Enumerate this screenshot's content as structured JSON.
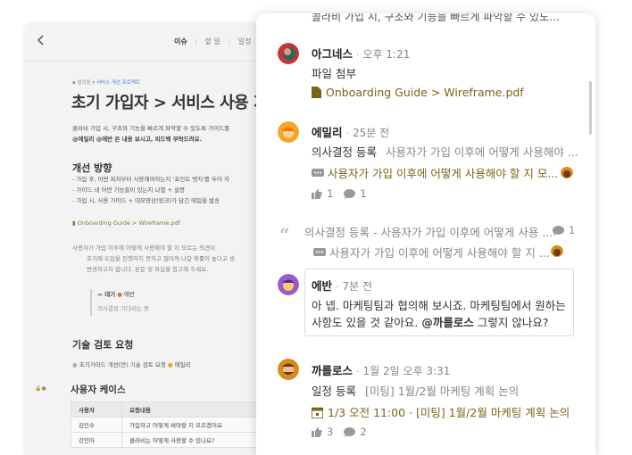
{
  "doc": {
    "tabs": [
      "이슈",
      "할 일",
      "일정"
    ],
    "breadcrumb": {
      "parent": "발의팀",
      "project": "서비스 개선 프로젝트"
    },
    "title": "초기 가입자 > 서비스 사용 가이드",
    "intro_line1": "콜라비 가입 시, 구조와 기능을 빠르게 파악할 수 있도록 가이드를",
    "intro_line2": "@에밀리 @에반 은 내용 보시고, 피드백 부탁드려요.",
    "section1_title": "개선 방향",
    "bullets": [
      "- 가입 후, 어떤 피처부터 사용해야하는지 '포인트 뱃지'를 두어 자",
      "- 가이드 내 어떤 기능들이 있는지 나열 + 설명",
      "- 가입 시, 사용 가이드 + 데모영상(링크)가 담긴 메일을 발송"
    ],
    "file_name": "Onboarding Guide > Wireframe.pdf",
    "note_lines": [
      "사용자가 가입 이후에 어떻게 사용해야 할 지 모르는 의견이",
      "초기에 도입을 진행하지 못하고 떨어져 나갈 확률이 높다고 생",
      "변경하고자 합니다. 본문 및 파일을 참고해 주세요."
    ],
    "quote_status": "대기",
    "quote_user": "에반",
    "quote_text": "의사결정 기다리는 중",
    "section2_title": "기술 검토 요청",
    "tech_item": "초기가이드 개선(안) 기술 검토 요청",
    "tech_user": "에밀리",
    "section3_title": "사용자 케이스",
    "table": {
      "headers": [
        "사용자",
        "요청내용"
      ],
      "rows": [
        [
          "김민수",
          "가입하고 어떻게 써야할 지 모르겠어요"
        ],
        [
          "강민아",
          "콜라비는 어떻게 사용할 수 있나요?"
        ]
      ]
    }
  },
  "panel": {
    "cut_line": "콜라비 가입 시, 구조와 기능을 빠르게 파악할 수 있도…",
    "comments": [
      {
        "name": "아그네스",
        "time": "오후 1:21",
        "line1": "파일 첨부",
        "attachment": "Onboarding Guide > Wireframe.pdf"
      },
      {
        "name": "에밀리",
        "time": "25분 전",
        "line1_label": "의사결정 등록",
        "line1_text": "사용자가 가입 이후에 어떻게 사용해야 ...",
        "link": "사용자가 가입 이후에 어떻게 사용해야 할 지 모...",
        "likes": "1",
        "replies": "1"
      },
      {
        "quote_label": "의사결정 등록",
        "quote_text": "- 사용자가 가입 이후에 어떻게 사용 ...",
        "quote_count": "1",
        "quote_link": "사용자가 가입 이후에 어떻게 사용해야 할 지 ..."
      },
      {
        "name": "에반",
        "time": "7분 전",
        "body_line1": "아 넵. 마케팅팀과 협의해 보시죠. 마케팅팀에서 원하는",
        "body_line2_a": "사항도 있을 것 같아요.",
        "mention": "@까를로스",
        "body_line2_b": "그렇지 않나요?"
      },
      {
        "name": "까를로스",
        "time": "1월 2일 오후 3:31",
        "line1_label": "일정 등록",
        "line1_text": "[미팅] 1월/2월 마케팅 계획 논의",
        "event": "1/3 오전 11:00 · [미팅] 1월/2월 마케팅 계획 논의",
        "likes": "3",
        "replies": "2"
      }
    ]
  },
  "colors": {
    "accent_gold": "#7a6418",
    "link_blue": "#3a6fd8"
  }
}
